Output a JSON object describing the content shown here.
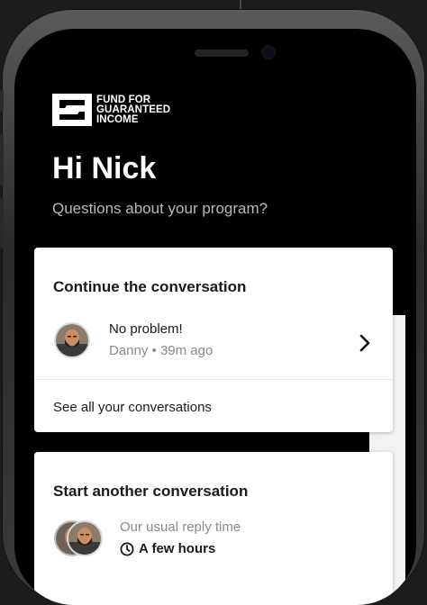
{
  "brand": {
    "logo_line1": "FUND FOR",
    "logo_line2": "GUARANTEED",
    "logo_line3": "INCOME"
  },
  "header": {
    "greeting": "Hi Nick",
    "subtitle": "Questions about your program?"
  },
  "continue_card": {
    "title": "Continue the conversation",
    "conversation": {
      "message": "No problem!",
      "meta": "Danny • 39m ago",
      "avatar_icon": "person-avatar-icon",
      "chevron_icon": "chevron-right-icon"
    },
    "see_all": "See all your conversations"
  },
  "start_card": {
    "title": "Start another conversation",
    "reply_time_label": "Our usual reply time",
    "reply_time_value": "A few hours",
    "clock_icon": "clock-icon"
  },
  "colors": {
    "screen_background": "#000000",
    "card_background": "#ffffff",
    "muted_text": "#8a8a8a",
    "primary_text": "#1a1a1a"
  }
}
